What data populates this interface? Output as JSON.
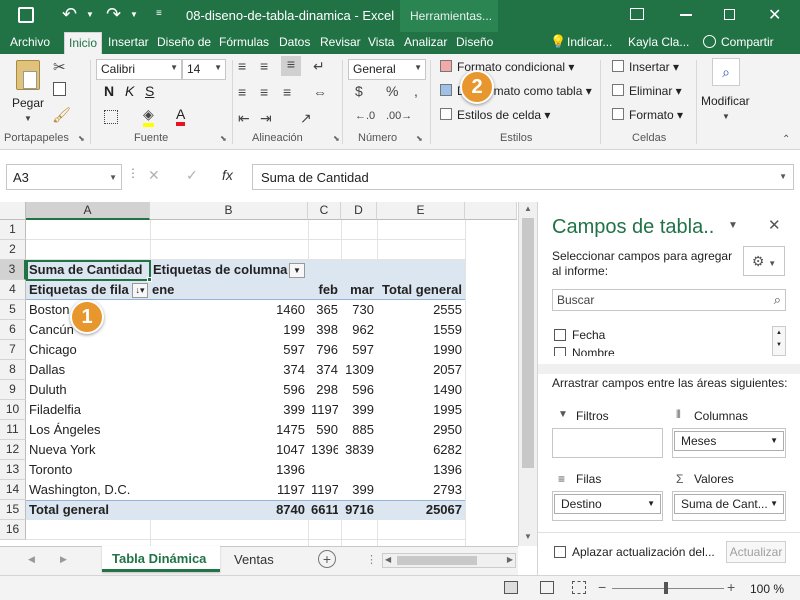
{
  "window": {
    "filename": "08-diseno-de-tabla-dinamica",
    "app": "Excel",
    "context_tab": "Herramientas..."
  },
  "tabs": [
    "Archivo",
    "Inicio",
    "Insertar",
    "Diseño de",
    "Fórmulas",
    "Datos",
    "Revisar",
    "Vista",
    "Analizar",
    "Diseño"
  ],
  "tell_me": "Indicar...",
  "user": "Kayla Cla...",
  "share": "Compartir",
  "ribbon": {
    "paste": "Pegar",
    "font_name": "Calibri",
    "font_size": "14",
    "number_format": "General",
    "cond_format": "Formato condicional",
    "format_table": "Dar formato como tabla",
    "cell_styles": "Estilos de celda",
    "insert": "Insertar",
    "delete": "Eliminar",
    "format": "Formato",
    "modify": "Modificar",
    "groups": {
      "clipboard": "Portapapeles",
      "font": "Fuente",
      "align": "Alineación",
      "number": "Número",
      "styles": "Estilos",
      "cells": "Celdas"
    }
  },
  "formula_bar": {
    "name_box": "A3",
    "formula": "Suma de Cantidad",
    "fx": "fx"
  },
  "columns": [
    "A",
    "B",
    "C",
    "D",
    "E"
  ],
  "rows": [
    {
      "n": "1",
      "a": "",
      "b": "",
      "c": "",
      "d": "",
      "e": ""
    },
    {
      "n": "2",
      "a": "",
      "b": "",
      "c": "",
      "d": "",
      "e": ""
    },
    {
      "n": "3",
      "a": "Suma de Cantidad",
      "b": "Etiquetas de columna",
      "c": "",
      "d": "",
      "e": ""
    },
    {
      "n": "4",
      "a": "Etiquetas de fila",
      "b": "ene",
      "c": "feb",
      "d": "mar",
      "e": "Total general"
    },
    {
      "n": "5",
      "a": "Boston",
      "b": "1460",
      "c": "365",
      "d": "730",
      "e": "2555"
    },
    {
      "n": "6",
      "a": "Cancún",
      "b": "199",
      "c": "398",
      "d": "962",
      "e": "1559"
    },
    {
      "n": "7",
      "a": "Chicago",
      "b": "597",
      "c": "796",
      "d": "597",
      "e": "1990"
    },
    {
      "n": "8",
      "a": "Dallas",
      "b": "374",
      "c": "374",
      "d": "1309",
      "e": "2057"
    },
    {
      "n": "9",
      "a": "Duluth",
      "b": "596",
      "c": "298",
      "d": "596",
      "e": "1490"
    },
    {
      "n": "10",
      "a": "Filadelfia",
      "b": "399",
      "c": "1197",
      "d": "399",
      "e": "1995"
    },
    {
      "n": "11",
      "a": "Los Ángeles",
      "b": "1475",
      "c": "590",
      "d": "885",
      "e": "2950"
    },
    {
      "n": "12",
      "a": "Nueva York",
      "b": "1047",
      "c": "1396",
      "d": "3839",
      "e": "6282"
    },
    {
      "n": "13",
      "a": "Toronto",
      "b": "1396",
      "c": "",
      "d": "",
      "e": "1396"
    },
    {
      "n": "14",
      "a": "Washington, D.C.",
      "b": "1197",
      "c": "1197",
      "d": "399",
      "e": "2793"
    },
    {
      "n": "15",
      "a": "Total general",
      "b": "8740",
      "c": "6611",
      "d": "9716",
      "e": "25067"
    },
    {
      "n": "16",
      "a": "",
      "b": "",
      "c": "",
      "d": "",
      "e": ""
    }
  ],
  "sheet_tabs": [
    "Tabla Dinámica",
    "Ventas"
  ],
  "zoom": "100 %",
  "pane": {
    "title": "Campos de tabla..",
    "subtitle": "Seleccionar campos para agregar al informe:",
    "search": "Buscar",
    "fields": [
      "Fecha",
      "Nombre"
    ],
    "drag_hint": "Arrastrar campos entre las áreas siguientes:",
    "filters": "Filtros",
    "columns": "Columnas",
    "columns_item": "Meses",
    "rows": "Filas",
    "rows_item": "Destino",
    "values": "Valores",
    "values_item": "Suma de Cant...",
    "defer": "Aplazar actualización del...",
    "update": "Actualizar"
  },
  "callouts": [
    "1",
    "2"
  ],
  "colors": {
    "excel_green": "#217346",
    "pivot_header": "#dce6f1",
    "badge": "#e8962e"
  }
}
